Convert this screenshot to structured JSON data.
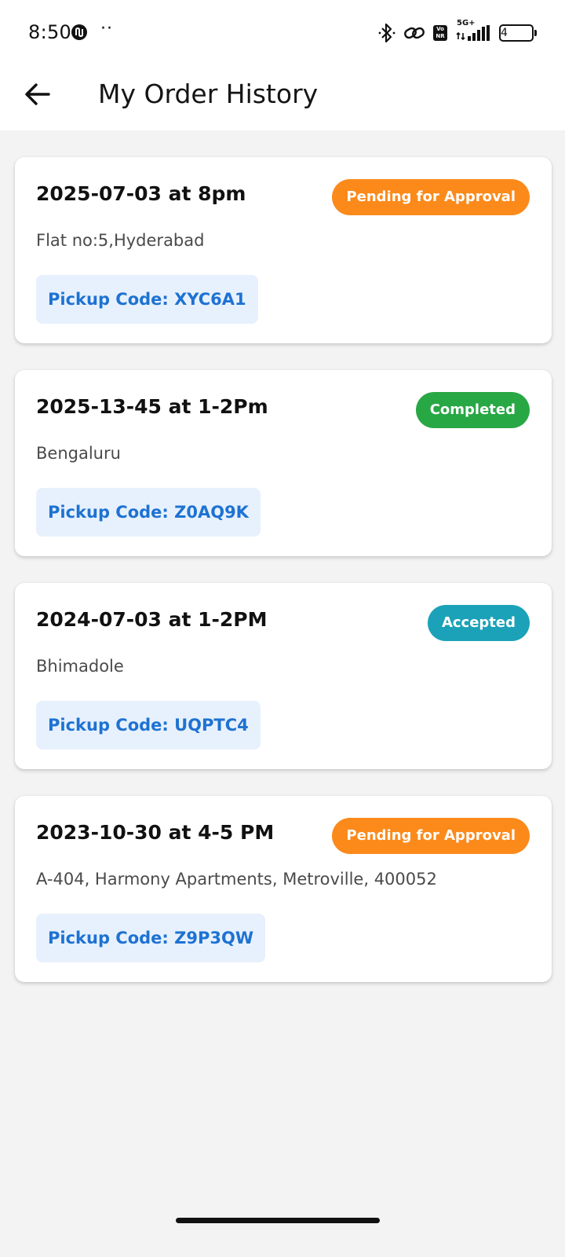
{
  "status_bar": {
    "time": "8:50",
    "dots": "··",
    "battery_level": "4",
    "network_label": "5G+",
    "volte_top": "Vo",
    "volte_bottom": "NR"
  },
  "header": {
    "title": "My Order History"
  },
  "colors": {
    "pending": "#fb8a1b",
    "completed": "#28a745",
    "accepted": "#1ba2b8",
    "pickup_text": "#1e72d2",
    "pickup_bg": "#e7f1fd"
  },
  "orders": [
    {
      "date": "2025-07-03 at 8pm",
      "address": "Flat no:5,Hyderabad",
      "status": "Pending for Approval",
      "status_type": "pending",
      "pickup": "Pickup Code: XYC6A1"
    },
    {
      "date": "2025-13-45 at 1-2Pm",
      "address": "Bengaluru",
      "status": "Completed",
      "status_type": "completed",
      "pickup": "Pickup Code: Z0AQ9K"
    },
    {
      "date": "2024-07-03 at 1-2PM",
      "address": "Bhimadole",
      "status": "Accepted",
      "status_type": "accepted",
      "pickup": "Pickup Code: UQPTC4"
    },
    {
      "date": "2023-10-30 at 4-5 PM",
      "address": "A-404, Harmony Apartments, Metroville, 400052",
      "status": "Pending for Approval",
      "status_type": "pending",
      "pickup": "Pickup Code: Z9P3QW"
    }
  ]
}
